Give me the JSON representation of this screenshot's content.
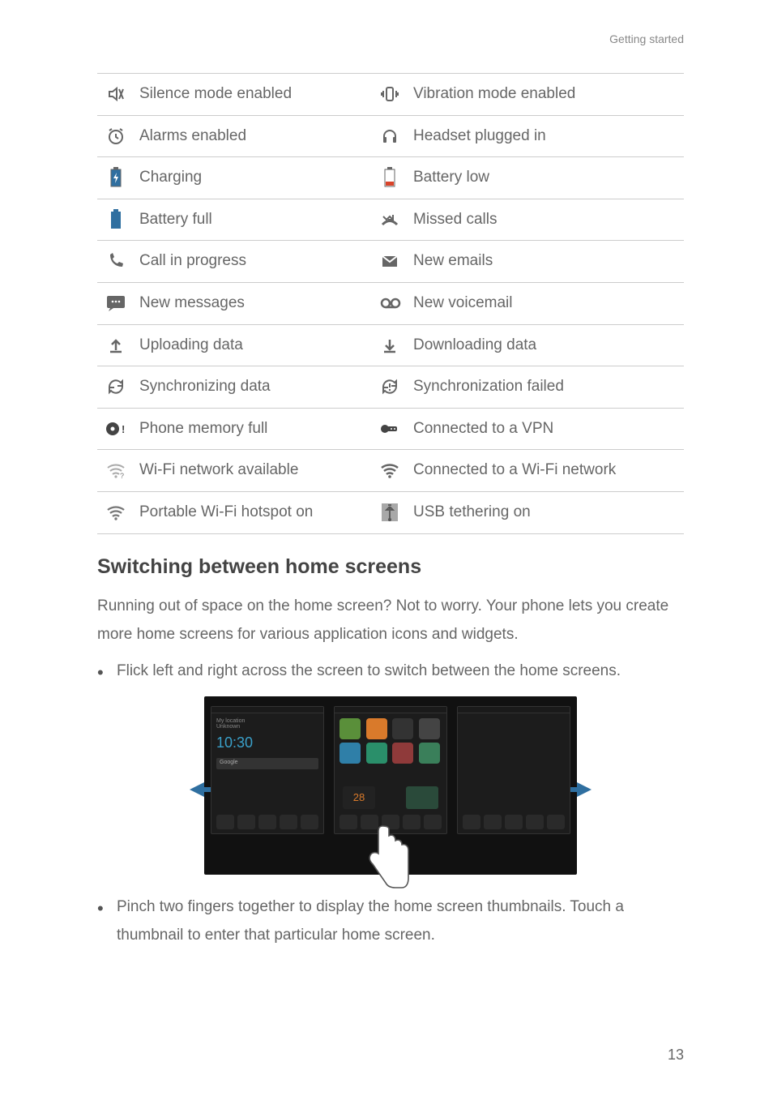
{
  "header": {
    "label": "Getting started"
  },
  "status_table": [
    {
      "left": "Silence mode enabled",
      "right": "Vibration mode enabled"
    },
    {
      "left": "Alarms enabled",
      "right": "Headset plugged in"
    },
    {
      "left": "Charging",
      "right": "Battery low"
    },
    {
      "left": "Battery full",
      "right": "Missed calls"
    },
    {
      "left": "Call in progress",
      "right": "New emails"
    },
    {
      "left": "New messages",
      "right": "New voicemail"
    },
    {
      "left": "Uploading data",
      "right": "Downloading data"
    },
    {
      "left": "Synchronizing data",
      "right": "Synchronization failed"
    },
    {
      "left": "Phone memory full",
      "right": "Connected to a VPN"
    },
    {
      "left": "Wi-Fi network available",
      "right": "Connected to a Wi-Fi network"
    },
    {
      "left": "Portable Wi-Fi hotspot on",
      "right": "USB tethering on"
    }
  ],
  "section_title": "Switching between home screens",
  "paragraph": "Running out of space on the home screen? Not to worry. Your phone lets you create more home screens for various application icons and widgets.",
  "bullets": [
    "Flick left and right across the screen to switch between the home screens.",
    "Pinch two fingers together to display the home screen thumbnails. Touch a thumbnail to enter that particular home screen."
  ],
  "page_number": "13"
}
